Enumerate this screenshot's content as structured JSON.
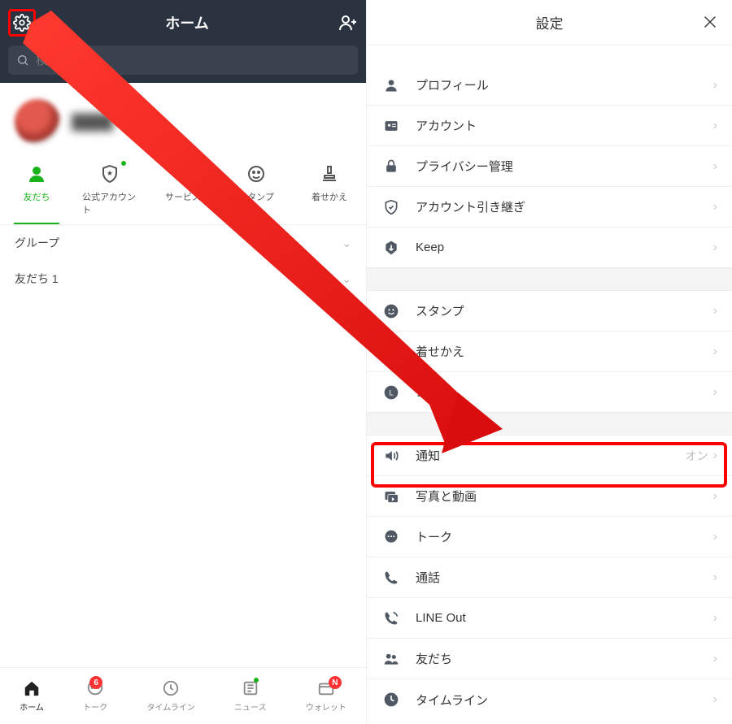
{
  "left": {
    "title": "ホーム",
    "search_placeholder": "検索",
    "profile_name": "████",
    "tabs": [
      {
        "label": "友だち"
      },
      {
        "label": "公式アカウント"
      },
      {
        "label": "サービス"
      },
      {
        "label": "スタンプ"
      },
      {
        "label": "着せかえ"
      }
    ],
    "sections": [
      {
        "label": "グループ"
      },
      {
        "label": "友だち 1"
      }
    ],
    "bottom_nav": [
      {
        "label": "ホーム"
      },
      {
        "label": "トーク",
        "badge": "6"
      },
      {
        "label": "タイムライン"
      },
      {
        "label": "ニュース"
      },
      {
        "label": "ウォレット",
        "badge": "N"
      }
    ]
  },
  "right": {
    "title": "設定",
    "groups": [
      [
        {
          "icon": "person",
          "label": "プロフィール"
        },
        {
          "icon": "idcard",
          "label": "アカウント"
        },
        {
          "icon": "lock",
          "label": "プライバシー管理"
        },
        {
          "icon": "shield",
          "label": "アカウント引き継ぎ"
        },
        {
          "icon": "keep",
          "label": "Keep"
        }
      ],
      [
        {
          "icon": "smile",
          "label": "スタンプ"
        },
        {
          "icon": "theme",
          "label": "着せかえ"
        },
        {
          "icon": "coin",
          "label": "コイン"
        }
      ],
      [
        {
          "icon": "speaker",
          "label": "通知",
          "value": "オン"
        },
        {
          "icon": "media",
          "label": "写真と動画"
        },
        {
          "icon": "chat",
          "label": "トーク"
        },
        {
          "icon": "phone",
          "label": "通話"
        },
        {
          "icon": "lineout",
          "label": "LINE Out"
        },
        {
          "icon": "friends",
          "label": "友だち"
        },
        {
          "icon": "clock",
          "label": "タイムライン"
        }
      ]
    ]
  }
}
